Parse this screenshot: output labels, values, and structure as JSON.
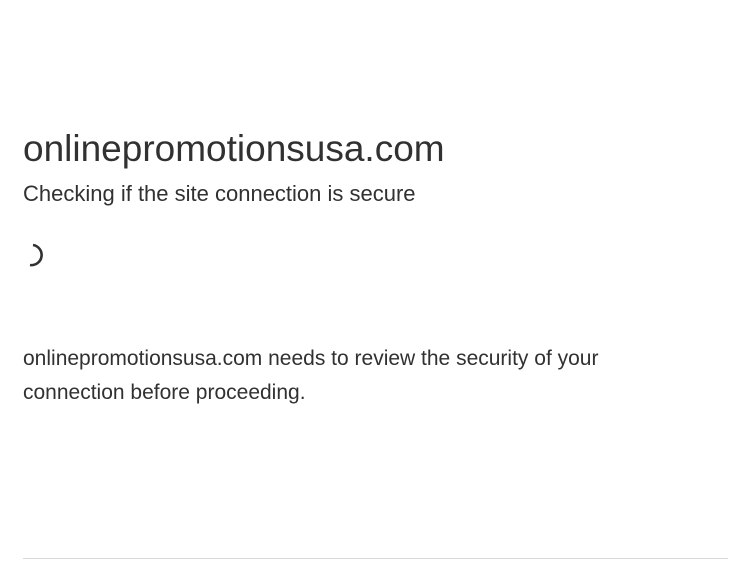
{
  "page": {
    "site_name": "onlinepromotionsusa.com",
    "status_heading": "Checking if the site connection is secure",
    "message": "onlinepromotionsusa.com needs to review the security of your connection before proceeding."
  },
  "icons": {
    "spinner": "loading-spinner-icon"
  },
  "colors": {
    "text": "#313131",
    "background": "#ffffff",
    "divider": "#d9d9d9"
  }
}
